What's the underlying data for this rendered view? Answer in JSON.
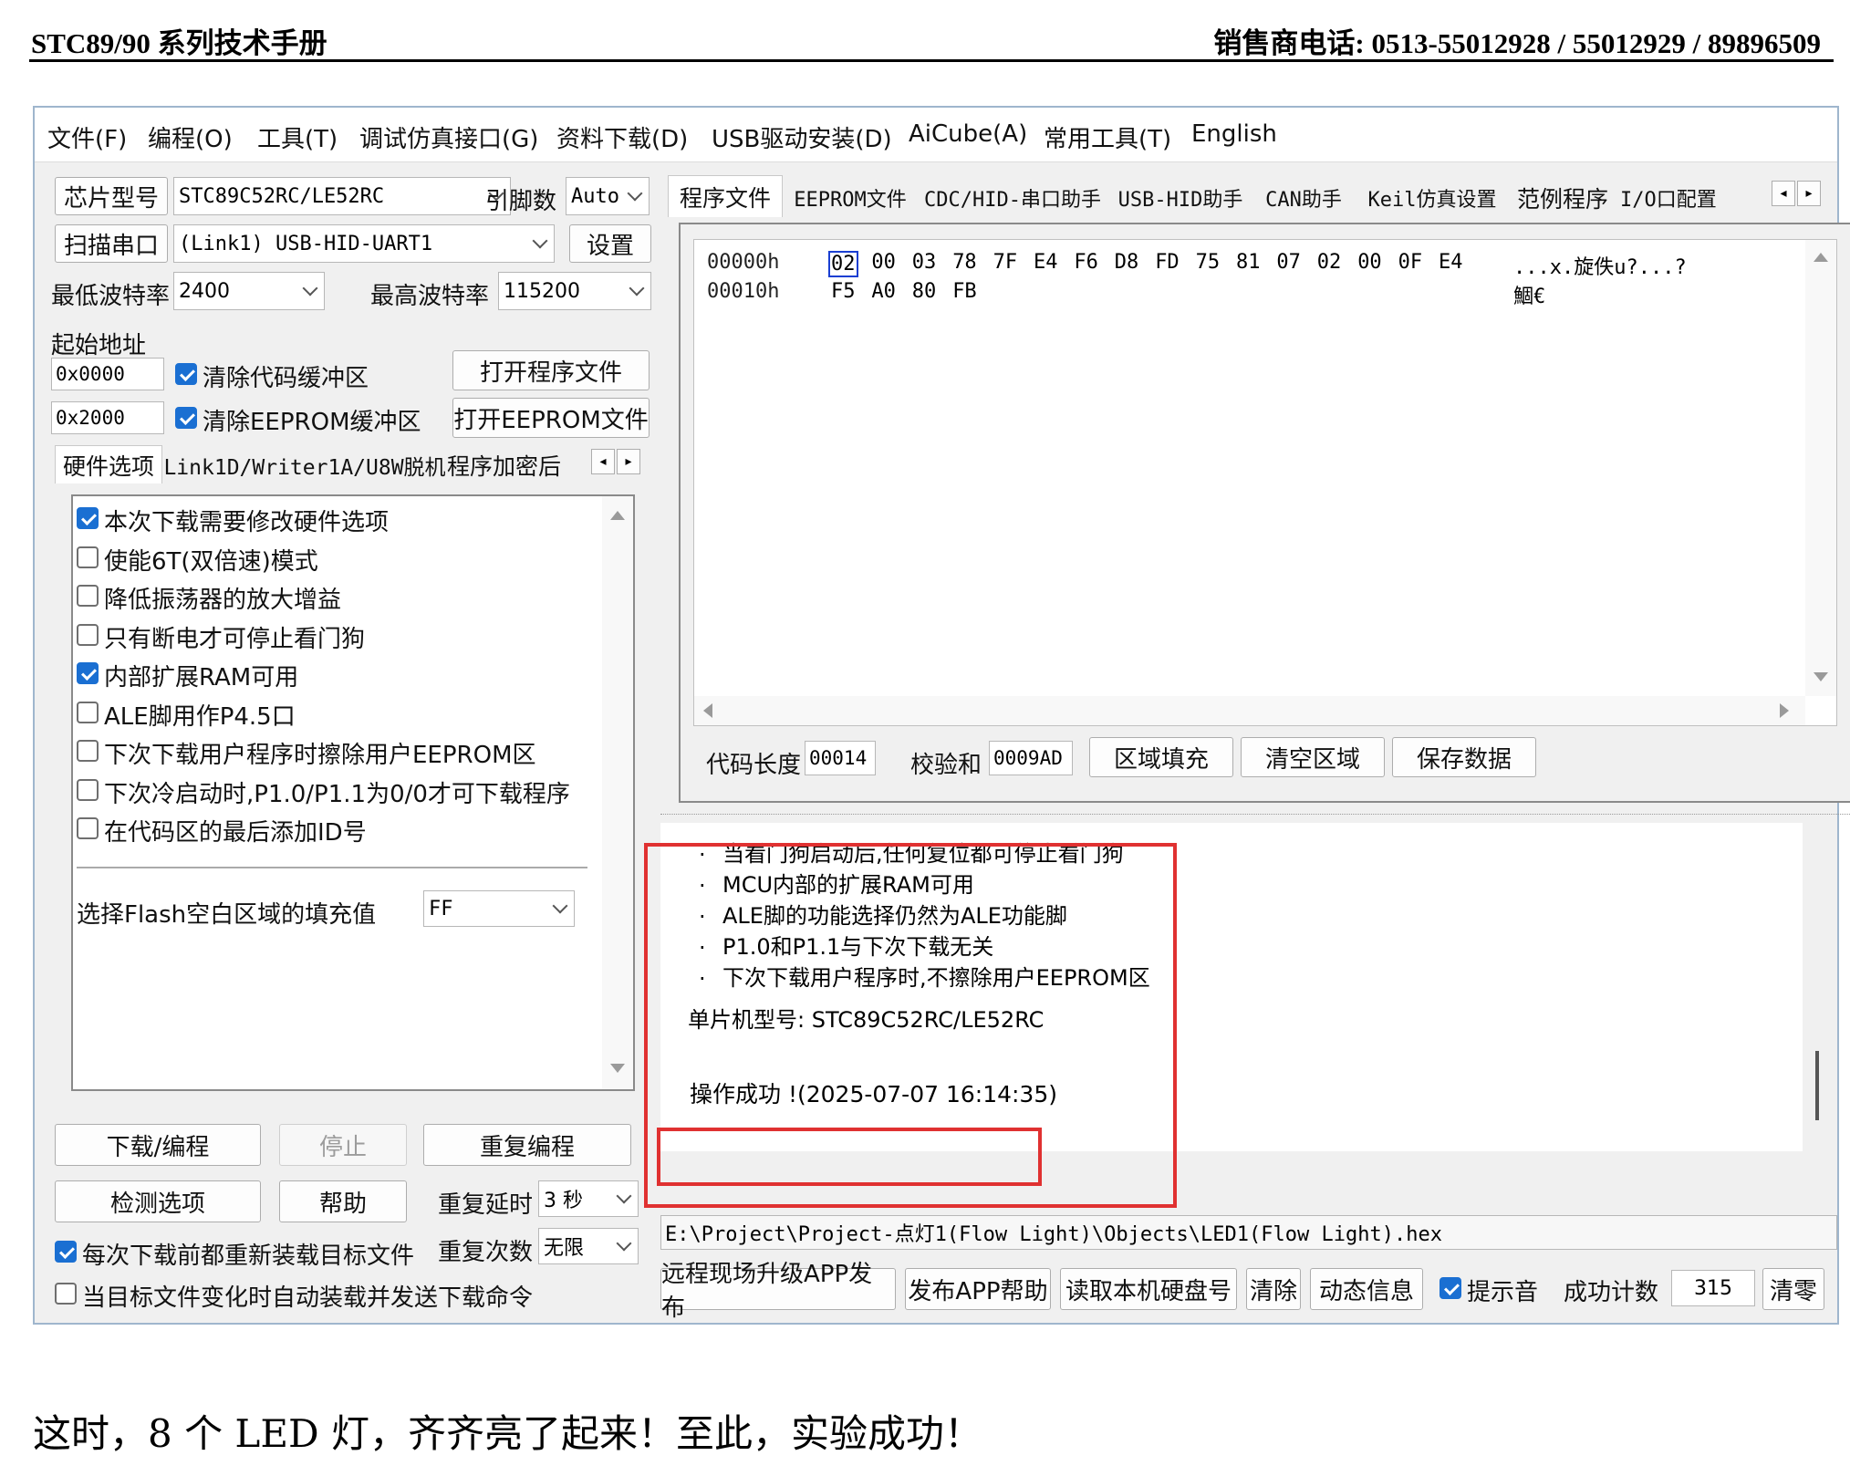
{
  "doc_header": {
    "left": "STC89/90 系列技术手册",
    "right": "销售商电话: 0513-55012928 / 55012929 / 89896509"
  },
  "doc_footer": "这时，8 个 LED 灯，齐齐亮了起来！至此，实验成功！",
  "menu": [
    "文件(F)",
    "编程(O)",
    "工具(T)",
    "调试仿真接口(G)",
    "资料下载(D)",
    "USB驱动安装(D)",
    "AiCube(A)",
    "常用工具(T)",
    "English"
  ],
  "chip": {
    "label": "芯片型号",
    "value": "STC89C52RC/LE52RC",
    "pins_label": "引脚数",
    "pins_value": "Auto"
  },
  "port": {
    "label": "扫描串口",
    "value": "(Link1) USB-HID-UART1",
    "settings": "设置"
  },
  "baud": {
    "min_label": "最低波特率",
    "min_value": "2400",
    "max_label": "最高波特率",
    "max_value": "115200"
  },
  "start": {
    "label": "起始地址",
    "code_addr": "0x0000",
    "clear_code": "清除代码缓冲区",
    "open_prog": "打开程序文件",
    "eeprom_addr": "0x2000",
    "clear_eeprom": "清除EEPROM缓冲区",
    "open_eeprom": "打开EEPROM文件"
  },
  "left_tabs": [
    "硬件选项",
    "Link1D/Writer1A/U8W脱机",
    "程序加密后"
  ],
  "hw_options": [
    {
      "label": "本次下载需要修改硬件选项",
      "checked": true
    },
    {
      "label": "使能6T(双倍速)模式",
      "checked": false
    },
    {
      "label": "降低振荡器的放大增益",
      "checked": false
    },
    {
      "label": "只有断电才可停止看门狗",
      "checked": false
    },
    {
      "label": "内部扩展RAM可用",
      "checked": true
    },
    {
      "label": "ALE脚用作P4.5口",
      "checked": false
    },
    {
      "label": "下次下载用户程序时擦除用户EEPROM区",
      "checked": false
    },
    {
      "label": "下次冷启动时,P1.0/P1.1为0/0才可下载程序",
      "checked": false
    },
    {
      "label": "在代码区的最后添加ID号",
      "checked": false
    }
  ],
  "fill": {
    "label": "选择Flash空白区域的填充值",
    "value": "FF"
  },
  "actions": {
    "download": "下载/编程",
    "stop": "停止",
    "reprog": "重复编程",
    "check": "检测选项",
    "help": "帮助",
    "delay_label": "重复延时",
    "delay_value": "3 秒",
    "count_label": "重复次数",
    "count_value": "无限"
  },
  "reload": {
    "each": "每次下载前都重新装载目标文件",
    "auto": "当目标文件变化时自动装载并发送下载命令"
  },
  "right_tabs": [
    "程序文件",
    "EEPROM文件",
    "CDC/HID-串口助手",
    "USB-HID助手",
    "CAN助手",
    "Keil仿真设置",
    "范例程序",
    "I/O口配置"
  ],
  "hex": {
    "rows": [
      {
        "addr": "00000h",
        "bytes": [
          "02",
          "00",
          "03",
          "78",
          "7F",
          "E4",
          "F6",
          "D8",
          "FD",
          "75",
          "81",
          "07",
          "02",
          "00",
          "0F",
          "E4"
        ],
        "ascii": "...x.旋佚u?...?"
      },
      {
        "addr": "00010h",
        "bytes": [
          "F5",
          "A0",
          "80",
          "FB"
        ],
        "ascii": "鯝€"
      }
    ]
  },
  "code_info": {
    "len_label": "代码长度",
    "len_value": "00014",
    "sum_label": "校验和",
    "sum_value": "0009AD",
    "fill_btn": "区域填充",
    "clear_btn": "清空区域",
    "save_btn": "保存数据"
  },
  "log": {
    "lines": [
      "当看门狗启动后,任何复位都可停止看门狗",
      "MCU内部的扩展RAM可用",
      "ALE脚的功能选择仍然为ALE功能脚",
      "P1.0和P1.1与下次下载无关",
      "下次下载用户程序时,不擦除用户EEPROM区"
    ],
    "model": "单片机型号: STC89C52RC/LE52RC",
    "success": "操作成功 !(2025-07-07 16:14:35)"
  },
  "file_path": "E:\\Project\\Project-点灯1(Flow Light)\\Objects\\LED1(Flow Light).hex",
  "bottom": {
    "remote": "远程现场升级APP发布",
    "app_help": "发布APP帮助",
    "disk": "读取本机硬盘号",
    "clear": "清除",
    "dyn": "动态信息",
    "beep": "提示音",
    "succ_label": "成功计数",
    "succ_value": "315",
    "reset": "清零"
  },
  "colors": {
    "highlight": "#e03131",
    "check_blue": "#1a6fd2",
    "hex_select": "#1a3fd2"
  }
}
